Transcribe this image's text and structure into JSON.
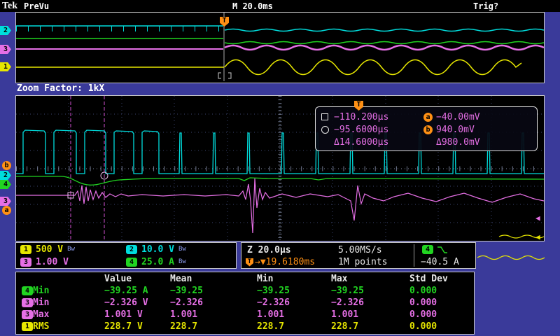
{
  "colors": {
    "background": "#3a3a9a",
    "ch1": "#e6e600",
    "ch2": "#00dcdc",
    "ch3": "#e56fe5",
    "ch4": "#21d421",
    "trigger": "#ff9014"
  },
  "top_bar": {
    "logo": "Tek",
    "status": "PreVu",
    "timebase": "M 20.0ms",
    "trigger_status": "Trig?"
  },
  "zoom_factor_label": "Zoom Factor: 1kX",
  "overview": {
    "trigger_marker": "T",
    "channel_markers": [
      {
        "ch": "2"
      },
      {
        "ch": "3"
      },
      {
        "ch": "1"
      }
    ]
  },
  "zoom": {
    "left_markers": {
      "b": "b",
      "ch2": "2",
      "ch4": "4",
      "ch3": "3",
      "a": "a"
    },
    "right_markers": {
      "ch3": "◀",
      "ch1": "◀"
    }
  },
  "cursor_readout": {
    "trigger_marker": "T",
    "time_square": "−110.200µs",
    "time_circle": "−95.6000µs",
    "time_delta": "Δ14.6000µs",
    "a_label": "a",
    "a_value": "−40.00mV",
    "b_label": "b",
    "b_value": "940.0mV",
    "amp_delta": "Δ980.0mV"
  },
  "channels": [
    {
      "ch": "1",
      "scale": "500 V",
      "bw": "Bw"
    },
    {
      "ch": "2",
      "scale": "10.0 V",
      "bw": "Bw"
    },
    {
      "ch": "3",
      "scale": "1.00 V",
      "bw": ""
    },
    {
      "ch": "4",
      "scale": "25.0 A",
      "bw": "Bw"
    }
  ],
  "acquisition": {
    "zoom_scale": "Z 20.0µs",
    "sample_rate": "5.00MS/s",
    "trigger_flag": "T",
    "trigger_arrow": "→▼",
    "trigger_time": "19.6180ms",
    "record_length": "1M points",
    "trigger_source": "4",
    "trigger_level": "−40.5 A"
  },
  "measurements": {
    "headers": [
      "Value",
      "Mean",
      "Min",
      "Max",
      "Std Dev"
    ],
    "rows": [
      {
        "ch": "4",
        "name": "Min",
        "values": [
          "−39.25 A",
          "−39.25",
          "−39.25",
          "−39.25",
          "0.000"
        ]
      },
      {
        "ch": "3",
        "name": "Min",
        "values": [
          "−2.326 V",
          "−2.326",
          "−2.326",
          "−2.326",
          "0.000"
        ]
      },
      {
        "ch": "3",
        "name": "Max",
        "values": [
          "1.001 V",
          "1.001",
          "1.001",
          "1.001",
          "0.000"
        ]
      },
      {
        "ch": "1",
        "name": "RMS",
        "values": [
          "228.7 V",
          "228.7",
          "228.7",
          "228.7",
          "0.000"
        ]
      }
    ]
  }
}
